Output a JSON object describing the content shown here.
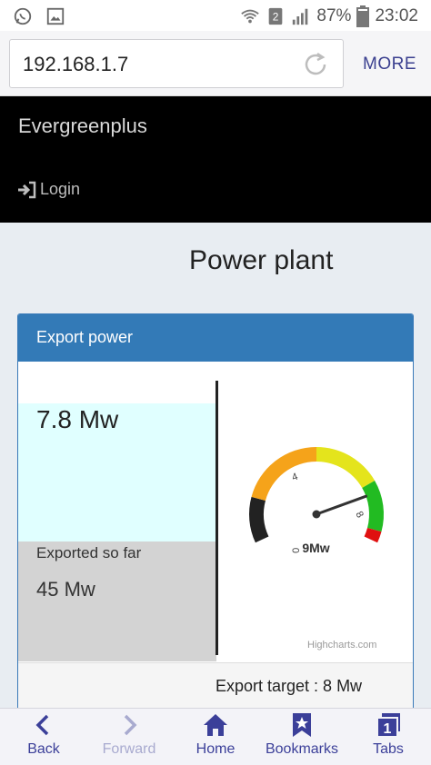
{
  "status_bar": {
    "battery": "87%",
    "time": "23:02",
    "sim_slot": "2",
    "icons": [
      "whatsapp-icon",
      "image-icon",
      "wifi-icon",
      "sim-icon",
      "signal-icon",
      "battery-icon"
    ]
  },
  "browser": {
    "url": "192.168.1.7",
    "more_label": "MORE"
  },
  "app": {
    "brand": "Evergreenplus",
    "login_label": "Login"
  },
  "page": {
    "title": "Power plant"
  },
  "panel": {
    "title": "Export power",
    "current_power": "7.8 Mw",
    "exported_label": "Exported so far",
    "exported_value": "45 Mw",
    "gauge": {
      "min_label": "0",
      "mid_label": "4",
      "max_label": "8",
      "readout": "9Mw",
      "credits": "Highcharts.com",
      "needle_value": 9,
      "range": [
        0,
        10
      ],
      "bands": [
        {
          "from": 0,
          "to": 2.5,
          "color": "#222222"
        },
        {
          "from": 2.5,
          "to": 5,
          "color": "#f5a31a"
        },
        {
          "from": 5,
          "to": 7,
          "color": "#e4e41c"
        },
        {
          "from": 7,
          "to": 8.5,
          "color": "#22bb22"
        },
        {
          "from": 8.5,
          "to": 10,
          "color": "#e01010"
        }
      ]
    },
    "target_label": "Export target : 8 Mw"
  },
  "bottom_nav": [
    {
      "label": "Back",
      "icon": "chevron-left-icon",
      "enabled": true
    },
    {
      "label": "Forward",
      "icon": "chevron-right-icon",
      "enabled": false
    },
    {
      "label": "Home",
      "icon": "home-icon",
      "enabled": true
    },
    {
      "label": "Bookmarks",
      "icon": "bookmark-icon",
      "enabled": true
    },
    {
      "label": "Tabs",
      "icon": "tabs-icon",
      "enabled": true,
      "badge": "1"
    }
  ],
  "colors": {
    "accent": "#337ab7",
    "nav": "#3b3f99",
    "current_bg": "#e0ffff",
    "exported_bg": "#d3d3d3"
  }
}
